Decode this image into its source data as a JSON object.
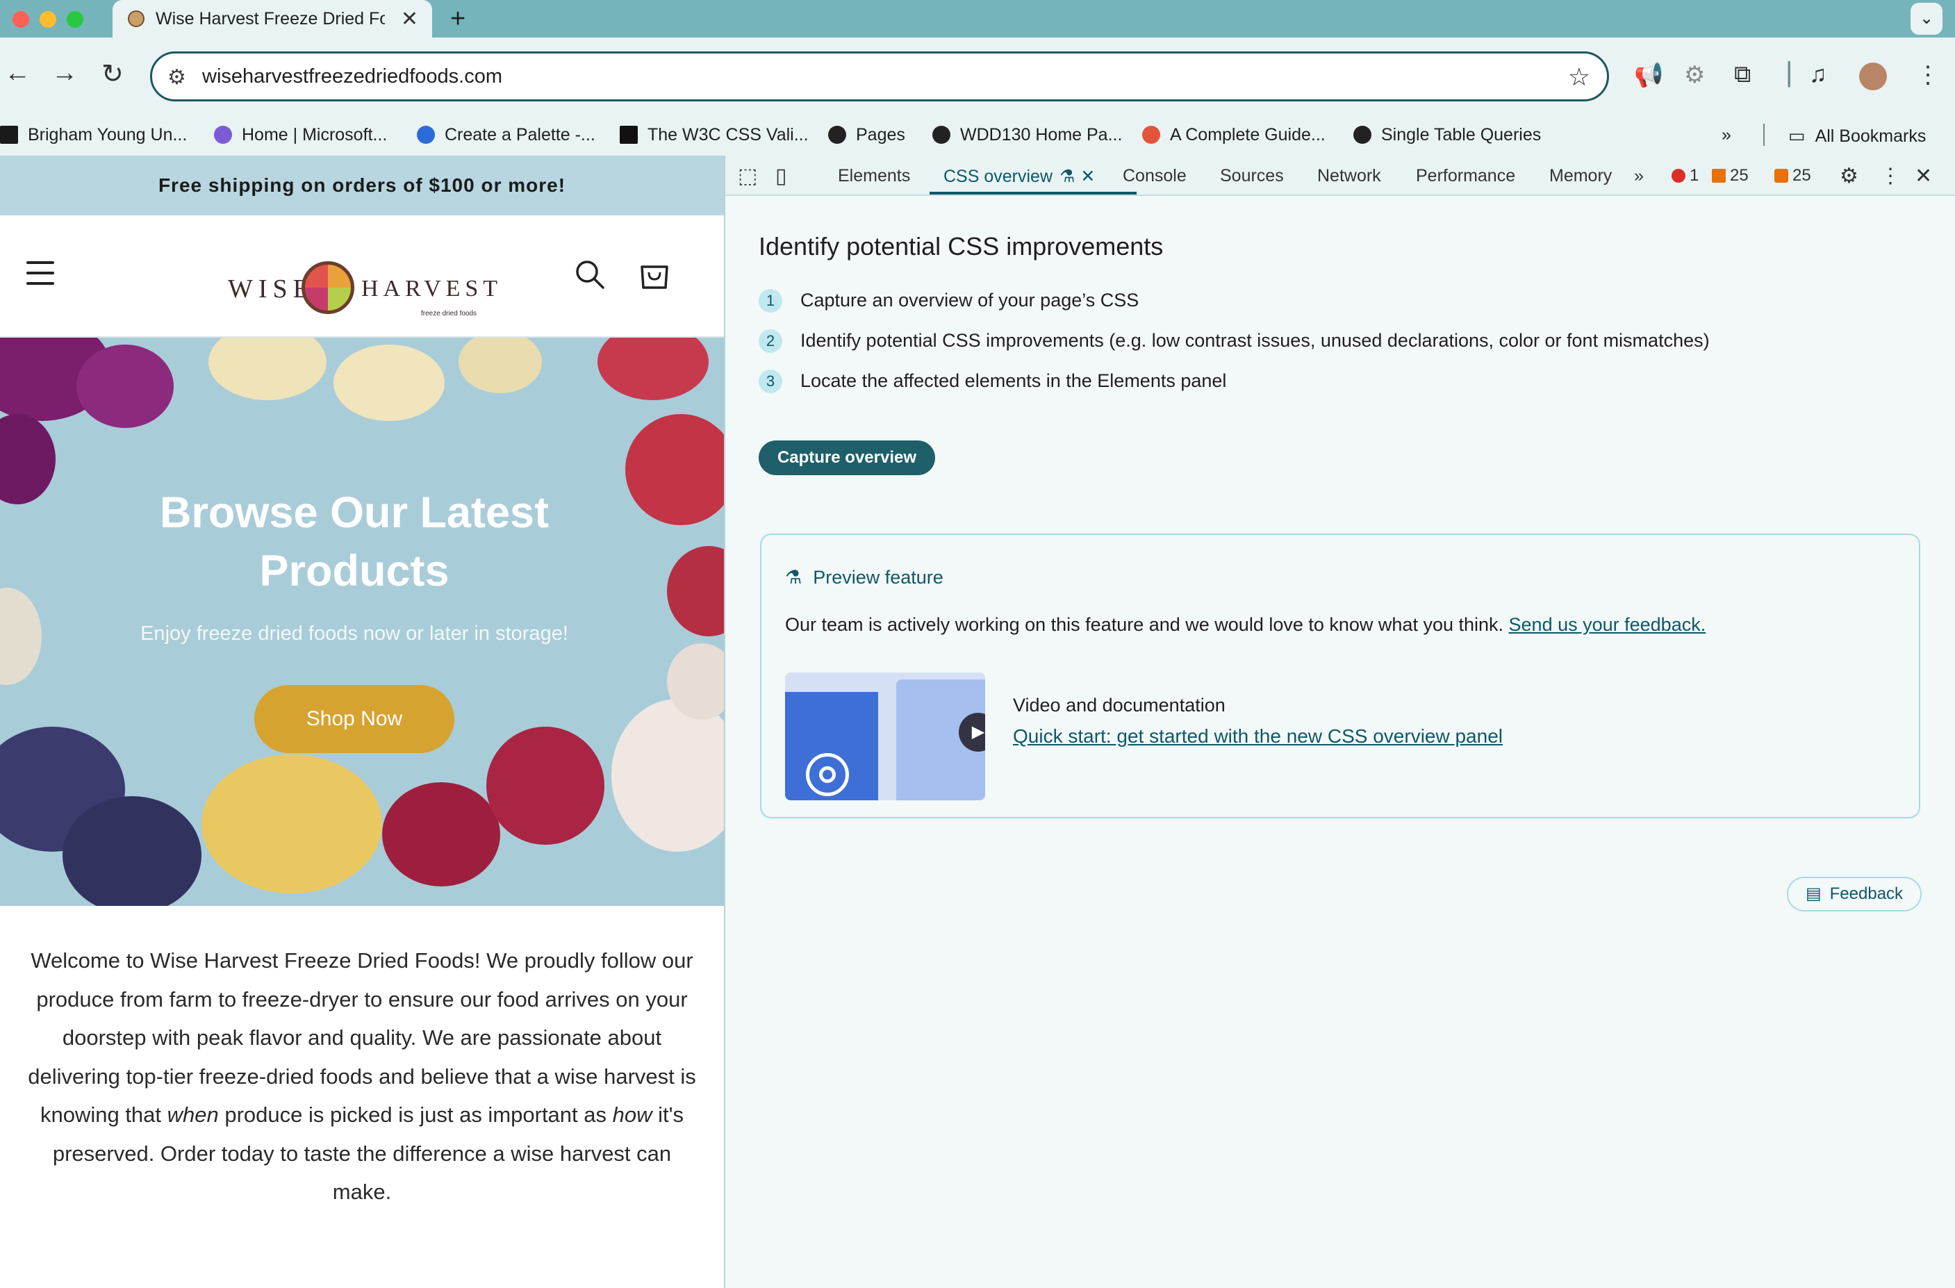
{
  "browser": {
    "tab_title": "Wise Harvest Freeze Dried Foods",
    "new_tab": "+",
    "url": "wiseharvestfreezedriedfoods.com",
    "bookmarks": [
      {
        "label": "Brigham Young Un...",
        "icon_color": "#1a1a1a"
      },
      {
        "label": "Home | Microsoft...",
        "icon_color": "#7b5cd6"
      },
      {
        "label": "Create a Palette -...",
        "icon_color": "#2b6bd8"
      },
      {
        "label": "The W3C CSS Vali...",
        "icon_color": "#111111"
      },
      {
        "label": "Pages",
        "icon_color": "#222222"
      },
      {
        "label": "WDD130 Home Pa...",
        "icon_color": "#222222"
      },
      {
        "label": "A Complete Guide...",
        "icon_color": "#e2553a"
      },
      {
        "label": "Single Table Queries",
        "icon_color": "#222222"
      }
    ],
    "all_bookmarks": "All Bookmarks"
  },
  "site": {
    "announcement": "Free shipping on orders of $100 or more!",
    "logo_left": "WISE",
    "logo_right": "HARVEST",
    "logo_tagline": "freeze dried foods",
    "hero_title": "Browse Our Latest Products",
    "hero_subtitle": "Enjoy freeze dried foods now or later in storage!",
    "shop_button": "Shop Now",
    "intro_a": "Welcome to Wise Harvest Freeze Dried Foods! We proudly follow our produce from farm to freeze-dryer to ensure our food arrives on your doorstep with peak flavor and quality. We are passionate about delivering top-tier freeze-dried foods and believe that a wise harvest is knowing that ",
    "intro_em1": "when",
    "intro_b": " produce is picked is just as important as ",
    "intro_em2": "how",
    "intro_c": " it's preserved. Order today to taste the difference a wise harvest can make."
  },
  "devtools": {
    "tabs": [
      "Elements",
      "CSS overview",
      "Console",
      "Sources",
      "Network",
      "Performance",
      "Memory"
    ],
    "active_tab": "CSS overview",
    "errors": "1",
    "warnings": "25",
    "issues": "25",
    "heading": "Identify potential CSS improvements",
    "steps": [
      {
        "num": "1",
        "text": "Capture an overview of your page’s CSS"
      },
      {
        "num": "2",
        "text": "Identify potential CSS improvements (e.g. low contrast issues, unused declarations, color or font mismatches)"
      },
      {
        "num": "3",
        "text": "Locate the affected elements in the Elements panel"
      }
    ],
    "capture_button": "Capture overview",
    "preview_title": "Preview feature",
    "preview_text": "Our team is actively working on this feature and we would love to know what you think. ",
    "preview_link": "Send us your feedback.",
    "video_title": "Video and documentation",
    "video_link": "Quick start: get started with the new CSS overview panel",
    "feedback_button": "Feedback"
  },
  "colors": {
    "chrome_frame": "#76b4bb",
    "toolbar": "#e9f3f4",
    "announcement_bg": "#b7d6df",
    "hero_bg": "#a9ccd9",
    "shop_button": "#d6a330",
    "devtools_accent": "#0e5866",
    "capture_button": "#1e5f6a"
  }
}
